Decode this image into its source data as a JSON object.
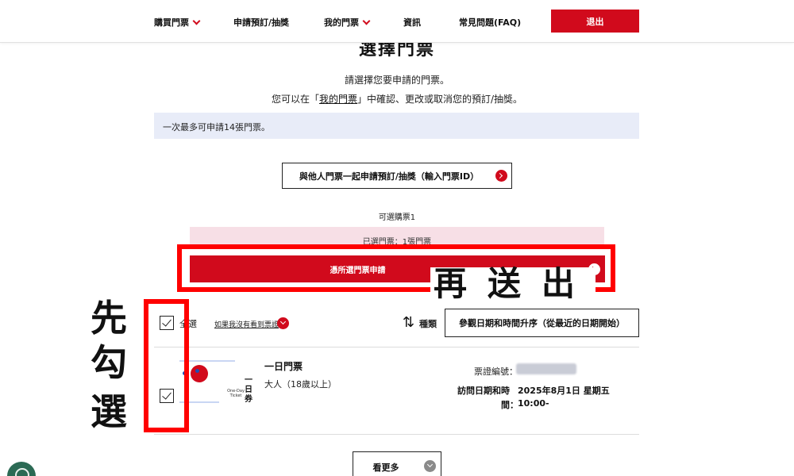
{
  "nav": {
    "items": [
      {
        "label": "購買門票",
        "has_dropdown": true
      },
      {
        "label": "申請預訂/抽獎",
        "has_dropdown": false
      },
      {
        "label": "我的門票",
        "has_dropdown": true
      },
      {
        "label": "資訊",
        "has_dropdown": false
      },
      {
        "label": "常見問題(FAQ)",
        "has_dropdown": false
      }
    ],
    "logout_label": "退出"
  },
  "page": {
    "title": "選擇門票",
    "intro_line1": "請選擇您要申請的門票。",
    "intro_line2_prefix": "您可以在「",
    "intro_line2_link": "我的門票",
    "intro_line2_suffix": "」中確認、更改或取消您的預訂/抽獎。",
    "limit_notice": "一次最多可申請14張門票。"
  },
  "joint_apply_label": "與他人門票一起申請預訂/抽獎（輸入門票ID）",
  "selectable_count": "可選購票1",
  "selected_count": "已選門票：1張門票",
  "apply_button_label": "憑所選門票申請",
  "list_controls": {
    "select_all_label": "全選",
    "not_found_link": "如果我沒有看到票證",
    "sort_label": "種類",
    "sort_value": "參觀日期和時間升序（從最近的日期開始）"
  },
  "ticket": {
    "name": "一日門票",
    "type": "大人（18歲以上）",
    "image_vertical_text": "一日券",
    "image_small_text": "One-Day Ticket",
    "id_label": "票證編號：",
    "visit_label_line1": "訪問日期和時",
    "visit_label_line2": "間：",
    "visit_date": "2025年8月1日 星期五",
    "visit_time": "10:00-"
  },
  "see_more_label": "看更多",
  "annotations": {
    "step_check": "先勾選",
    "step_send": "再送出"
  },
  "colors": {
    "brand_red": "#d10a1c",
    "annotation_red": "#ff0000",
    "info_bg": "#e8ecf8",
    "selected_bg": "#f7dfe6",
    "chat_green": "#2b6a54"
  }
}
